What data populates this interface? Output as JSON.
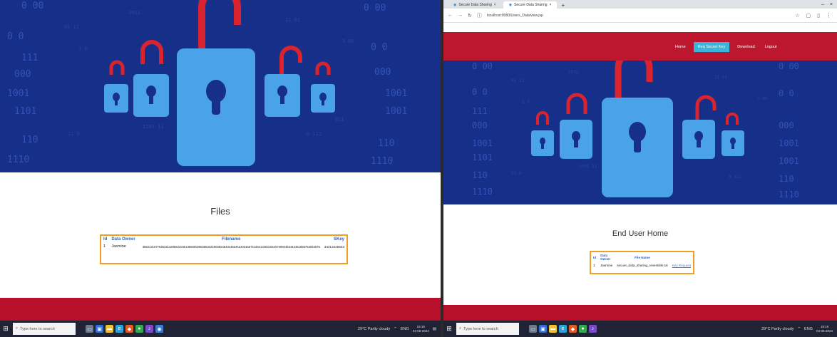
{
  "left": {
    "files_title": "Files",
    "table": {
      "headers": [
        "Id",
        "Data Owner",
        "Filename",
        "SKey"
      ],
      "rows": [
        {
          "id": "1",
          "owner": "Jasmine",
          "filename": "355313107763623132956310301359300295355332200392464344534422334a0741464134531644073994453443451656754934575",
          "skey": "34313425643"
        }
      ]
    }
  },
  "right": {
    "tabs": [
      {
        "label": "Secure Data Sharing"
      },
      {
        "label": "Secure Data Sharing"
      }
    ],
    "url": "localhost:8080/Users_Data/view.jsp",
    "nav": [
      {
        "label": "Home"
      },
      {
        "label": "Req Secret Key"
      },
      {
        "label": "Download"
      },
      {
        "label": "Logout"
      }
    ],
    "enduser_title": "End User Home",
    "table": {
      "headers": [
        "Id",
        "Data Owner",
        "File Name"
      ],
      "rows": [
        {
          "id": "1",
          "owner": "Jasmine",
          "filename": "secure_data_sharing_reversible.txt",
          "action": "Key Request"
        }
      ]
    }
  },
  "taskbar": {
    "search_placeholder": "Type here to search",
    "weather": "29°C Partly cloudy",
    "time": "19:19",
    "date": "04-06-2024",
    "lang": "ENG"
  },
  "colors": {
    "hero_bg": "#16308a",
    "accent_red": "#b8102a",
    "lock_blue": "#4aa3e8",
    "table_border": "#f0a020",
    "nav_active": "#3ab4d8"
  }
}
